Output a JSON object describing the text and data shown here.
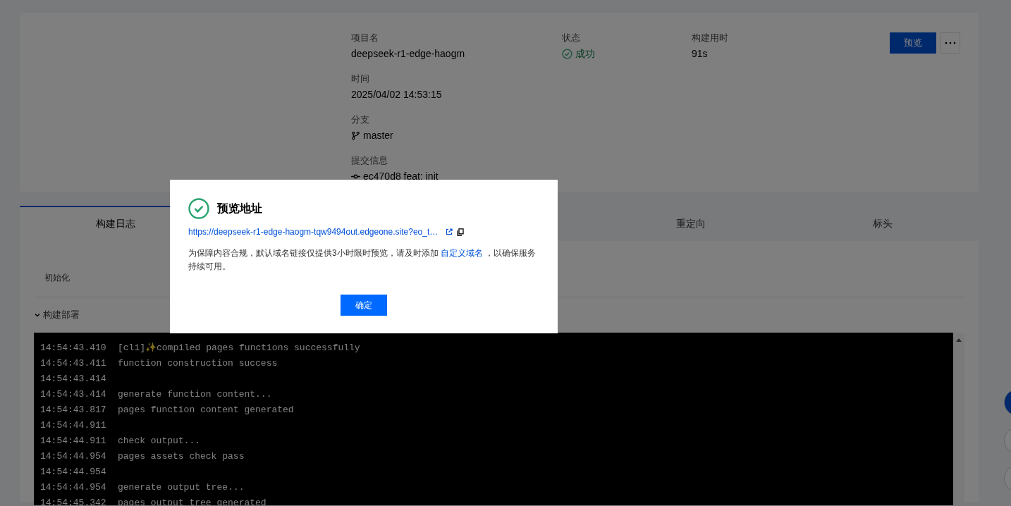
{
  "deployment": {
    "fields": [
      {
        "label": "项目名",
        "value": "deepseek-r1-edge-haogm",
        "kind": "text"
      },
      {
        "label": "状态",
        "value": "成功",
        "kind": "status"
      },
      {
        "label": "构建用时",
        "value": "91s",
        "kind": "text"
      },
      {
        "label": "时间",
        "value": "2025/04/02 14:53:15",
        "kind": "text"
      },
      {
        "label": "分支",
        "value": "master",
        "kind": "branch"
      },
      {
        "label": "提交信息",
        "value": "ec470d8 feat: init",
        "kind": "commit"
      }
    ],
    "preview_button": "预览"
  },
  "tabs": [
    {
      "label": "构建日志",
      "selected": true
    },
    {
      "label": "重定向",
      "selected": false
    },
    {
      "label": "标头",
      "selected": false
    }
  ],
  "stage": "初始化",
  "section": {
    "title": "构建部署",
    "expanded": true
  },
  "log": [
    {
      "time": "14:54:43.410",
      "message": "[cli]✨compiled pages functions successfully"
    },
    {
      "time": "14:54:43.411",
      "message": "function construction success"
    },
    {
      "time": "14:54:43.414"
    },
    {
      "time": "14:54:43.414",
      "message": "generate function content..."
    },
    {
      "time": "14:54:43.817",
      "message": "pages function content generated"
    },
    {
      "time": "14:54:44.911"
    },
    {
      "time": "14:54:44.911",
      "message": "check output..."
    },
    {
      "time": "14:54:44.954",
      "message": "pages assets check pass"
    },
    {
      "time": "14:54:44.954"
    },
    {
      "time": "14:54:44.954",
      "message": "generate output tree..."
    },
    {
      "time": "14:54:45.342",
      "message": "pages output tree generated"
    }
  ],
  "dialog": {
    "title": "预览地址",
    "url": "https://deepseek-r1-edge-haogm-tqw9494out.edgeone.site?eo_t…",
    "notice_before": "为保障内容合规，默认域名链接仅提供3小时限时预览，请及时添加 ",
    "notice_link": "自定义域名",
    "notice_after": " ，以确保服务持续可用。",
    "confirm": "确定"
  }
}
